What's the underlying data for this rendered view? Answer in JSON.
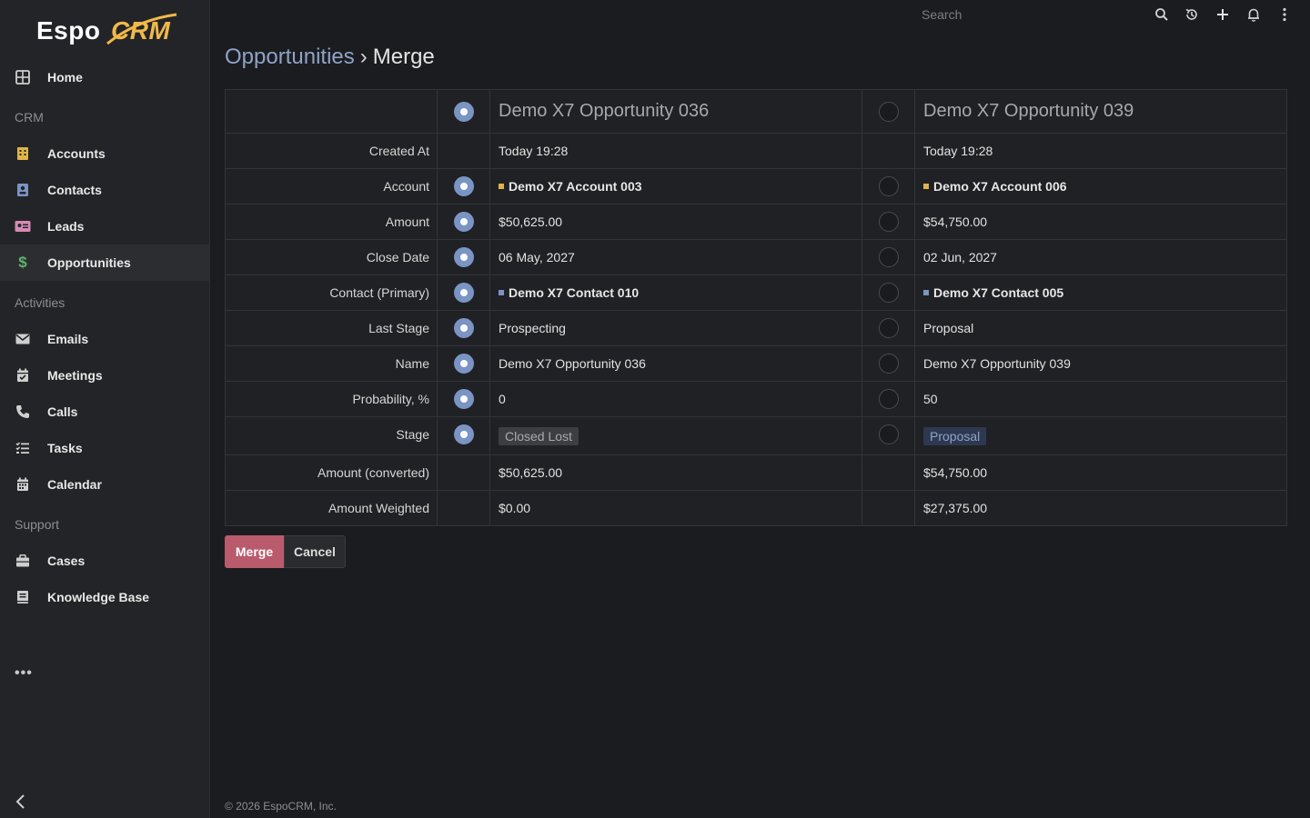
{
  "app": {
    "logo_text_espo": "Espo",
    "logo_text_crm": "CRM",
    "search_placeholder": "Search"
  },
  "sidebar": {
    "home": "Home",
    "groups": {
      "crm": "CRM",
      "activities": "Activities",
      "support": "Support"
    },
    "items": {
      "accounts": "Accounts",
      "contacts": "Contacts",
      "leads": "Leads",
      "opportunities": "Opportunities",
      "emails": "Emails",
      "meetings": "Meetings",
      "calls": "Calls",
      "tasks": "Tasks",
      "calendar": "Calendar",
      "cases": "Cases",
      "knowledge_base": "Knowledge Base"
    },
    "more": "•••"
  },
  "breadcrumb": {
    "parent": "Opportunities",
    "separator": "›",
    "current": "Merge"
  },
  "records": [
    {
      "title": "Demo X7 Opportunity 036",
      "selected": true
    },
    {
      "title": "Demo X7 Opportunity 039",
      "selected": false
    }
  ],
  "fields": {
    "created_at": {
      "label": "Created At",
      "v1": "Today 19:28",
      "v2": "Today 19:28"
    },
    "account": {
      "label": "Account",
      "v1": "Demo X7 Account 003",
      "v2": "Demo X7 Account 006"
    },
    "amount": {
      "label": "Amount",
      "v1": "$50,625.00",
      "v2": "$54,750.00"
    },
    "close_date": {
      "label": "Close Date",
      "v1": "06 May, 2027",
      "v2": "02 Jun, 2027"
    },
    "contact": {
      "label": "Contact (Primary)",
      "v1": "Demo X7 Contact 010",
      "v2": "Demo X7 Contact 005"
    },
    "last_stage": {
      "label": "Last Stage",
      "v1": "Prospecting",
      "v2": "Proposal"
    },
    "name": {
      "label": "Name",
      "v1": "Demo X7 Opportunity 036",
      "v2": "Demo X7 Opportunity 039"
    },
    "probability": {
      "label": "Probability, %",
      "v1": "0",
      "v2": "50"
    },
    "stage": {
      "label": "Stage",
      "v1": "Closed Lost",
      "v2": "Proposal"
    },
    "amount_converted": {
      "label": "Amount (converted)",
      "v1": "$50,625.00",
      "v2": "$54,750.00"
    },
    "amount_weighted": {
      "label": "Amount Weighted",
      "v1": "$0.00",
      "v2": "$27,375.00"
    }
  },
  "colors": {
    "account_marker": "#e0b44a",
    "contact_marker": "#7a94c4",
    "merge_button": "#b95b6d",
    "accent": "#7a94c4"
  },
  "buttons": {
    "merge": "Merge",
    "cancel": "Cancel"
  },
  "footer": {
    "copyright": "© 2026 EspoCRM, Inc."
  }
}
